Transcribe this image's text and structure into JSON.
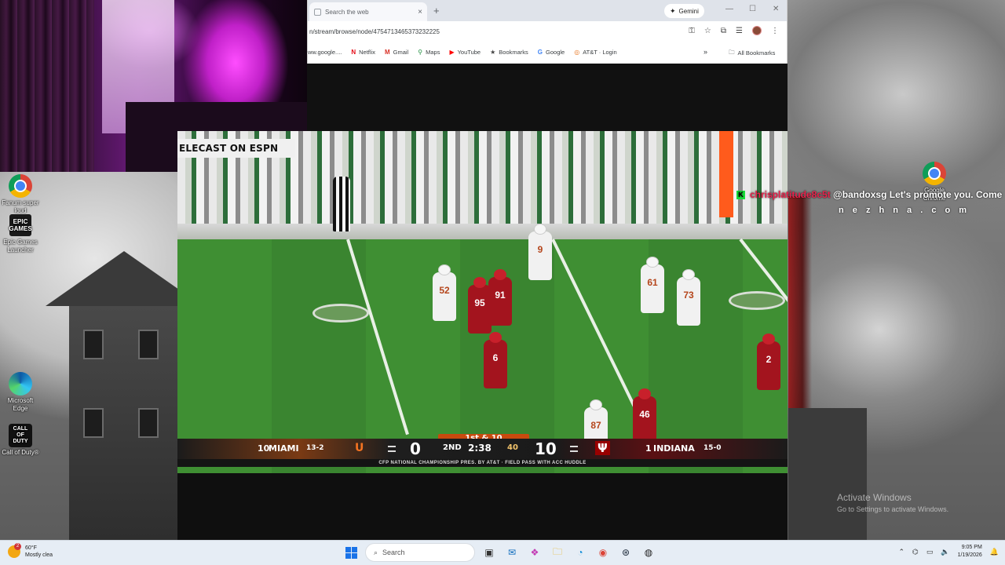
{
  "webcam": {},
  "desktop_icons": [
    {
      "label": "Fanum super loud",
      "glyph": ""
    },
    {
      "label": "Epic Games Launcher",
      "glyph": "EPIC GAMES"
    },
    {
      "label": "Microsoft Edge",
      "glyph": ""
    },
    {
      "label": "Call of Duty®",
      "glyph": "CALL OF DUTY"
    },
    {
      "label": "Google Chrome",
      "glyph": ""
    }
  ],
  "browser": {
    "tab_title": "Search the web",
    "tab_close": "×",
    "new_tab": "+",
    "gemini_label": "Gemini",
    "window_controls": {
      "minimize": "—",
      "maximize": "☐",
      "close": "✕"
    },
    "url": "n/stream/browse/node/4754713465373232225",
    "bookmarks": [
      {
        "label": "ww.google....",
        "icon": ""
      },
      {
        "label": "Netflix",
        "icon": "N"
      },
      {
        "label": "Gmail",
        "icon": "M"
      },
      {
        "label": "Maps",
        "icon": "⚲"
      },
      {
        "label": "YouTube",
        "icon": "▶"
      },
      {
        "label": "Bookmarks",
        "icon": "★"
      },
      {
        "label": "Google",
        "icon": "G"
      },
      {
        "label": "AT&T · Login",
        "icon": "◎"
      }
    ],
    "bookmarks_more": "»",
    "all_bookmarks": "All Bookmarks"
  },
  "broadcast": {
    "banner": "ELECAST ON ESPN",
    "down_distance": "1st & 10",
    "away": {
      "rank": "10",
      "name": "MIAMI",
      "record": "13-2",
      "score": "0"
    },
    "home": {
      "rank": "1",
      "name": "INDIANA",
      "record": "15-0",
      "score": "10"
    },
    "quarter": "2ND",
    "clock": "2:38",
    "play_clock": "40",
    "footer": "CFP NATIONAL CHAMPIONSHIP PRES. BY AT&T · FIELD PASS WITH ACC HUDDLE",
    "jerseys": [
      "52",
      "95",
      "91",
      "6",
      "9",
      "61",
      "73",
      "87",
      "46",
      "2"
    ]
  },
  "chat": {
    "username": "chrisplatitude8c5t",
    "message": "@bandoxsg Let's promote you. Come",
    "line2": "n e z h n a . c o m"
  },
  "watermark": {
    "title": "Activate Windows",
    "subtitle": "Go to Settings to activate Windows."
  },
  "taskbar": {
    "weather_temp": "60°F",
    "weather_desc": "Mostly clea",
    "weather_badge": "2",
    "search_label": "Search",
    "time": "9:05 PM",
    "date": "1/19/2026"
  },
  "colors": {
    "miami_orange": "#f47321",
    "indiana_red": "#990000",
    "chat_user": "#e8224b",
    "kick_green": "#18e03a"
  }
}
